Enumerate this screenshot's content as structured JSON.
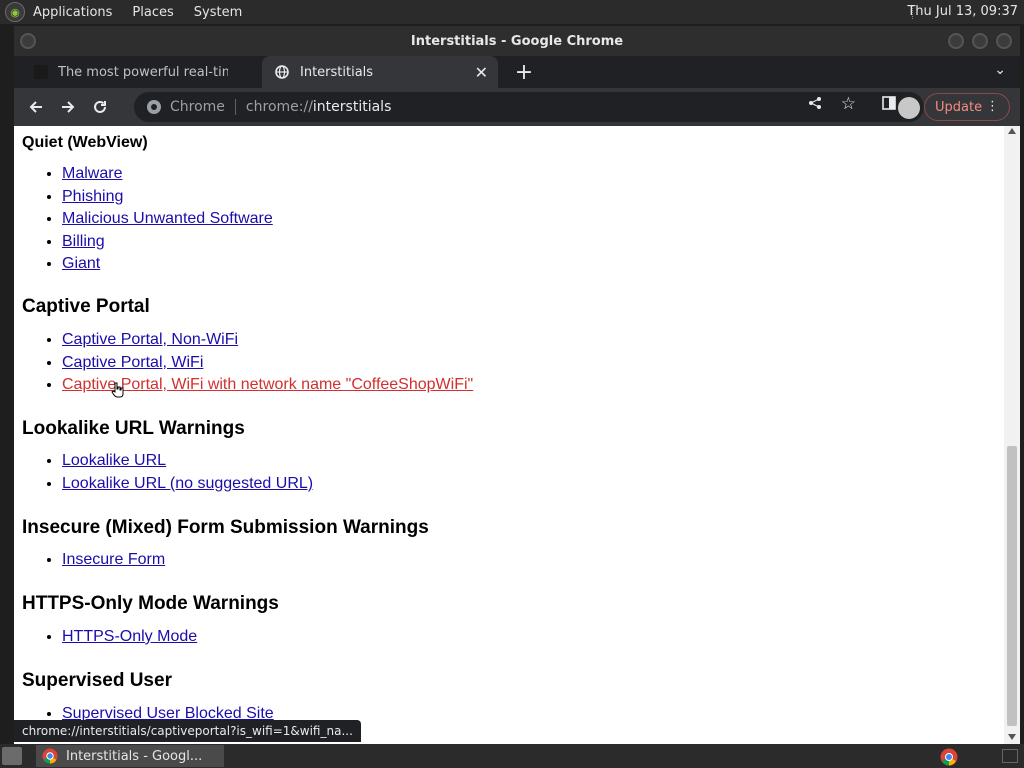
{
  "top_panel": {
    "menus": [
      "Applications",
      "Places",
      "System"
    ],
    "clock": "Thu Jul 13, 09:37"
  },
  "window": {
    "title": "Interstitials - Google Chrome"
  },
  "tabs": [
    {
      "title": "The most powerful real-time s",
      "active": false
    },
    {
      "title": "Interstitials",
      "active": true
    }
  ],
  "toolbar": {
    "origin_label": "Chrome",
    "url_scheme": "chrome://",
    "url_path": "interstitials",
    "update_label": "Update"
  },
  "page": {
    "sections": [
      {
        "heading": "Quiet (WebView)",
        "level": "h3",
        "links": [
          "Malware",
          "Phishing",
          "Malicious Unwanted Software",
          "Billing",
          "Giant"
        ]
      },
      {
        "heading": "Captive Portal",
        "level": "h2",
        "links": [
          "Captive Portal, Non-WiFi",
          "Captive Portal, WiFi",
          "Captive Portal, WiFi with network name \"CoffeeShopWiFi\""
        ]
      },
      {
        "heading": "Lookalike URL Warnings",
        "level": "h2",
        "links": [
          "Lookalike URL",
          "Lookalike URL (no suggested URL)"
        ]
      },
      {
        "heading": "Insecure (Mixed) Form Submission Warnings",
        "level": "h2",
        "links": [
          "Insecure Form"
        ]
      },
      {
        "heading": "HTTPS-Only Mode Warnings",
        "level": "h2",
        "links": [
          "HTTPS-Only Mode"
        ]
      },
      {
        "heading": "Supervised User",
        "level": "h2",
        "links": [
          "Supervised User Blocked Site"
        ]
      }
    ],
    "hovered_link": "Captive Portal, WiFi with network name \"CoffeeShopWiFi\""
  },
  "status_bar": {
    "url": "chrome://interstitials/captiveportal?is_wifi=1&wifi_na..."
  },
  "taskbar": {
    "items": [
      {
        "label": "Interstitials - Googl..."
      }
    ]
  },
  "colors": {
    "link": "#1a0dab",
    "hovered_link": "#d32f2f",
    "update_text": "#f28b82"
  }
}
